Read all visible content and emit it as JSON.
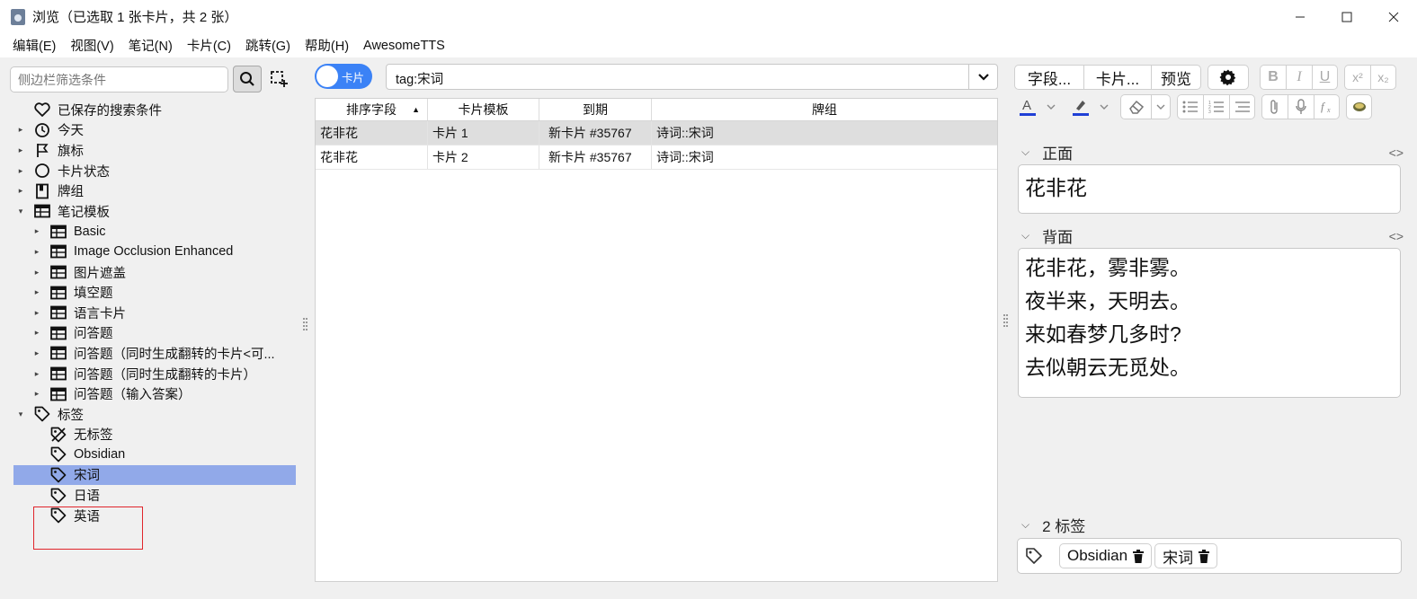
{
  "window": {
    "title": "浏览（已选取 1 张卡片，共 2 张）",
    "controls": {
      "minimize": "—",
      "maximize": "☐",
      "close": "✕"
    }
  },
  "menu": [
    "编辑(E)",
    "视图(V)",
    "笔记(N)",
    "卡片(C)",
    "跳转(G)",
    "帮助(H)",
    "AwesomeTTS"
  ],
  "sidebar": {
    "search_placeholder": "侧边栏筛选条件",
    "items": [
      {
        "label": "已保存的搜索条件",
        "icon": "heart-icon",
        "arrow": "",
        "level": 0
      },
      {
        "label": "今天",
        "icon": "clock-icon",
        "arrow": "▸",
        "level": 0
      },
      {
        "label": "旗标",
        "icon": "flag-icon",
        "arrow": "▸",
        "level": 0
      },
      {
        "label": "卡片状态",
        "icon": "circle-icon",
        "arrow": "▸",
        "level": 0
      },
      {
        "label": "牌组",
        "icon": "deck-icon",
        "arrow": "▸",
        "level": 0
      },
      {
        "label": "笔记模板",
        "icon": "notetype-icon",
        "arrow": "▾",
        "level": 0
      },
      {
        "label": "Basic",
        "icon": "notetype-icon",
        "arrow": "▸",
        "level": 1
      },
      {
        "label": "Image Occlusion Enhanced",
        "icon": "notetype-icon",
        "arrow": "▸",
        "level": 1
      },
      {
        "label": "图片遮盖",
        "icon": "notetype-icon",
        "arrow": "▸",
        "level": 1
      },
      {
        "label": "填空题",
        "icon": "notetype-icon",
        "arrow": "▸",
        "level": 1
      },
      {
        "label": "语言卡片",
        "icon": "notetype-icon",
        "arrow": "▸",
        "level": 1
      },
      {
        "label": "问答题",
        "icon": "notetype-icon",
        "arrow": "▸",
        "level": 1
      },
      {
        "label": "问答题（同时生成翻转的卡片<可...",
        "icon": "notetype-icon",
        "arrow": "▸",
        "level": 1
      },
      {
        "label": "问答题（同时生成翻转的卡片）",
        "icon": "notetype-icon",
        "arrow": "▸",
        "level": 1
      },
      {
        "label": "问答题（输入答案）",
        "icon": "notetype-icon",
        "arrow": "▸",
        "level": 1
      },
      {
        "label": "标签",
        "icon": "tag-icon",
        "arrow": "▾",
        "level": 0
      },
      {
        "label": "无标签",
        "icon": "tag-off-icon",
        "arrow": "",
        "level": 1
      },
      {
        "label": "Obsidian",
        "icon": "tag-icon",
        "arrow": "",
        "level": 1
      },
      {
        "label": "宋词",
        "icon": "tag-icon",
        "arrow": "",
        "level": 1,
        "selected": true
      },
      {
        "label": "日语",
        "icon": "tag-icon",
        "arrow": "",
        "level": 1
      },
      {
        "label": "英语",
        "icon": "tag-icon",
        "arrow": "",
        "level": 1
      }
    ]
  },
  "search": {
    "toggle_label": "卡片",
    "query": "tag:宋词"
  },
  "table": {
    "columns": [
      "排序字段",
      "卡片模板",
      "到期",
      "牌组"
    ],
    "sort_indicator": "▲",
    "rows": [
      {
        "cells": [
          "花非花",
          "卡片 1",
          "新卡片 #35767",
          "诗词::宋词"
        ],
        "selected": true
      },
      {
        "cells": [
          "花非花",
          "卡片 2",
          "新卡片 #35767",
          "诗词::宋词"
        ],
        "selected": false
      }
    ]
  },
  "editor": {
    "toolbar": {
      "fields_btn": "字段...",
      "cards_btn": "卡片...",
      "preview_btn": "预览",
      "bold": "B",
      "italic": "I",
      "underline": "U",
      "superscript": "x²",
      "subscript": "x₂",
      "text_color": "#1f3fd6",
      "highlight_color": "#1f3fd6"
    },
    "fields": [
      {
        "name": "正面",
        "code_toggle": "<>",
        "content": "花非花"
      },
      {
        "name": "背面",
        "code_toggle": "<>",
        "lines": [
          "花非花，雾非雾。",
          "夜半来，天明去。",
          "来如春梦几多时?",
          "去似朝云无觅处。"
        ]
      }
    ],
    "tags_header": "2 标签",
    "tags": [
      "Obsidian",
      "宋词"
    ]
  },
  "accent_color": "#3b82f6",
  "selection_color": "#91a9e9",
  "highlight_box_color": "#e0252b"
}
